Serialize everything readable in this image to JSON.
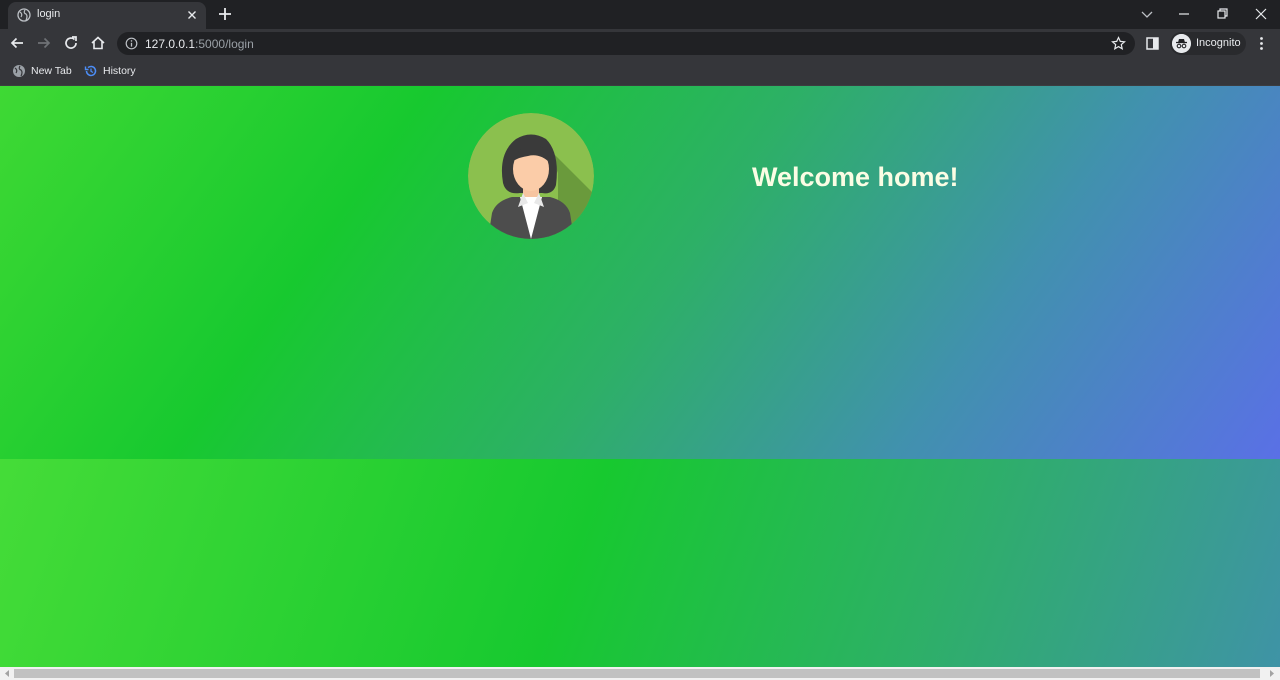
{
  "browser": {
    "tab_title": "login",
    "url_host": "127.0.0.1",
    "url_rest": ":5000/login",
    "profile_label": "Incognito"
  },
  "bookmarks": [
    {
      "label": "New Tab",
      "icon": "globe-icon"
    },
    {
      "label": "History",
      "icon": "history-icon"
    }
  ],
  "page": {
    "heading": "Welcome home!",
    "avatar_icon": "woman-avatar-icon"
  },
  "colors": {
    "hero_gradient": [
      "#3fd934",
      "#17c92f",
      "#2db066",
      "#4191ae",
      "#5a70e6"
    ],
    "heading_color": "#fbfde4"
  }
}
